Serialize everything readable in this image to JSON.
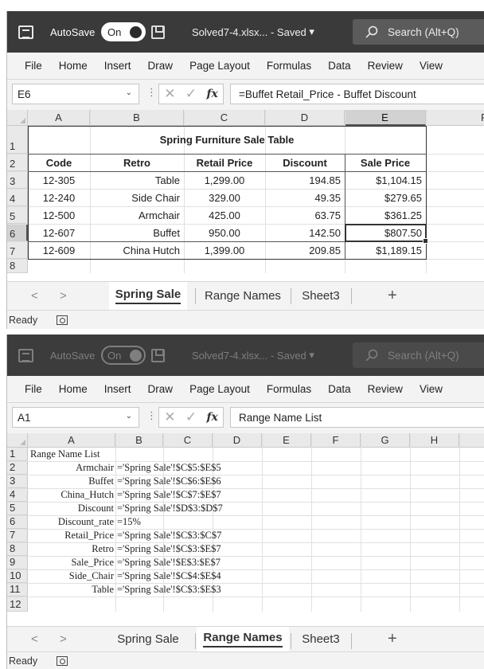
{
  "windows": [
    {
      "title_bar": {
        "autosave_label": "AutoSave",
        "autosave_state": "On",
        "filename": "Solved7-4.xlsx...  -  Saved",
        "filename_chevron": "▾",
        "search_placeholder": "Search (Alt+Q)"
      },
      "menu": [
        "File",
        "Home",
        "Insert",
        "Draw",
        "Page Layout",
        "Formulas",
        "Data",
        "Review",
        "View"
      ],
      "formula_bar": {
        "name_box": "E6",
        "formula": "=Buffet Retail_Price - Buffet Discount"
      },
      "columns": [
        "A",
        "B",
        "C",
        "D",
        "E",
        "F"
      ],
      "rows": [
        "1",
        "2",
        "3",
        "4",
        "5",
        "6",
        "7",
        "8"
      ],
      "selected_column": "E",
      "selected_row": "6",
      "table_title": "Spring Furniture Sale Table",
      "headers": [
        "Code",
        "Retro",
        "Retail Price",
        "Discount",
        "Sale Price"
      ],
      "data_rows": [
        [
          "12-305",
          "Table",
          "1,299.00",
          "194.85",
          "$1,104.15"
        ],
        [
          "12-240",
          "Side Chair",
          "329.00",
          "49.35",
          "$279.65"
        ],
        [
          "12-500",
          "Armchair",
          "425.00",
          "63.75",
          "$361.25"
        ],
        [
          "12-607",
          "Buffet",
          "950.00",
          "142.50",
          "$807.50"
        ],
        [
          "12-609",
          "China Hutch",
          "1,399.00",
          "209.85",
          "$1,189.15"
        ]
      ],
      "sheet_tabs": [
        {
          "label": "Spring Sale",
          "active": true
        },
        {
          "label": "Range Names",
          "active": false
        },
        {
          "label": "Sheet3",
          "active": false
        }
      ],
      "status": "Ready"
    },
    {
      "title_bar": {
        "autosave_label": "AutoSave",
        "autosave_state": "On",
        "filename": "Solved7-4.xlsx...  -  Saved",
        "filename_chevron": "▾",
        "search_placeholder": "Search (Alt+Q)"
      },
      "menu": [
        "File",
        "Home",
        "Insert",
        "Draw",
        "Page Layout",
        "Formulas",
        "Data",
        "Review",
        "View"
      ],
      "formula_bar": {
        "name_box": "A1",
        "formula": "Range Name List"
      },
      "columns": [
        "A",
        "B",
        "C",
        "D",
        "E",
        "F",
        "G",
        "H"
      ],
      "rows": [
        "1",
        "2",
        "3",
        "4",
        "5",
        "6",
        "7",
        "8",
        "9",
        "10",
        "11",
        "12"
      ],
      "list_title": "Range Name List",
      "range_names": [
        [
          "Armchair",
          "='Spring Sale'!$C$5:$E$5"
        ],
        [
          "Buffet",
          "='Spring Sale'!$C$6:$E$6"
        ],
        [
          "China_Hutch",
          "='Spring Sale'!$C$7:$E$7"
        ],
        [
          "Discount",
          "='Spring Sale'!$D$3:$D$7"
        ],
        [
          "Discount_rate",
          "=15%"
        ],
        [
          "Retail_Price",
          "='Spring Sale'!$C$3:$C$7"
        ],
        [
          "Retro",
          "='Spring Sale'!$C$3:$E$7"
        ],
        [
          "Sale_Price",
          "='Spring Sale'!$E$3:$E$7"
        ],
        [
          "Side_Chair",
          "='Spring Sale'!$C$4:$E$4"
        ],
        [
          "Table",
          "='Spring Sale'!$C$3:$E$3"
        ]
      ],
      "sheet_tabs": [
        {
          "label": "Spring Sale",
          "active": false
        },
        {
          "label": "Range Names",
          "active": true
        },
        {
          "label": "Sheet3",
          "active": false
        }
      ],
      "status": "Ready"
    }
  ],
  "icons": {
    "app": "excel-icon",
    "save": "save-icon",
    "search": "search-icon",
    "cancel": "✕",
    "enter": "✓",
    "fx": "fx",
    "dots": "⋮",
    "chevron": "⌄",
    "nav_prev": "<",
    "nav_next": ">",
    "add_sheet": "+"
  }
}
